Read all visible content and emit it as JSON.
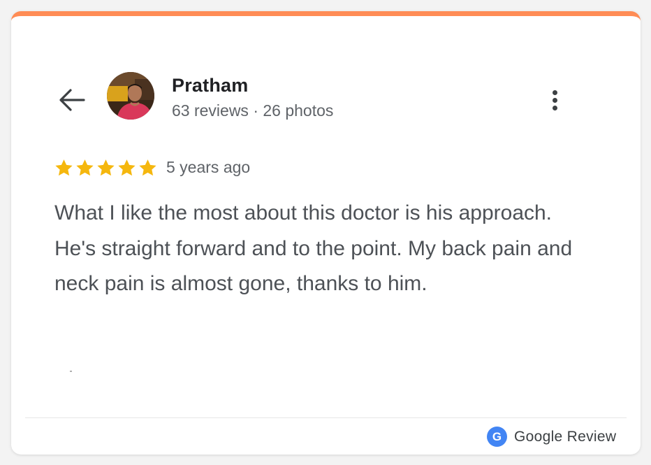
{
  "colors": {
    "accent_bar": "#ff8c55",
    "star": "#f5b70e",
    "google_badge": "#4285f4",
    "text_primary": "#202124",
    "text_secondary": "#5f6368"
  },
  "header": {
    "back_icon": "arrow-left-icon",
    "more_icon": "more-vert-icon"
  },
  "reviewer": {
    "name": "Pratham",
    "meta": "63 reviews · 26 photos",
    "avatar": "reviewer-photo"
  },
  "review": {
    "rating": 5,
    "rating_max": 5,
    "age": "5 years ago",
    "text": "What I like the most about this doctor is his approach. He's straight forward and to the point. My back pain and neck pain is almost gone, thanks to him."
  },
  "footer": {
    "badge_letter": "G",
    "source_label": "Google Review"
  }
}
